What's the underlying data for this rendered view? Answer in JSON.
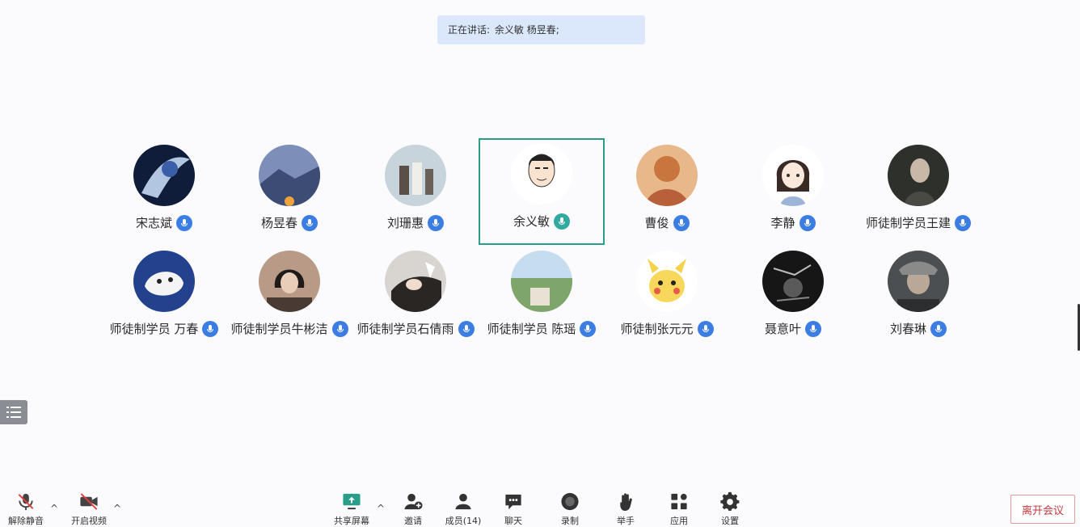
{
  "speaking": {
    "label": "正在讲话:",
    "names": "余义敏 杨昱春;"
  },
  "participants": [
    {
      "name": "宋志斌",
      "avatar": "avatar-night-swirl",
      "mic": "blue"
    },
    {
      "name": "杨昱春",
      "avatar": "avatar-mountain",
      "mic": "blue"
    },
    {
      "name": "刘珊惠",
      "avatar": "avatar-group-photo",
      "mic": "blue"
    },
    {
      "name": "余义敏",
      "avatar": "avatar-cartoon-man",
      "mic": "green",
      "active": true
    },
    {
      "name": "曹俊",
      "avatar": "avatar-painting",
      "mic": "blue"
    },
    {
      "name": "李静",
      "avatar": "avatar-cartoon-girl",
      "mic": "blue"
    },
    {
      "name": "师徒制学员王建",
      "avatar": "avatar-dark-portrait",
      "mic": "blue"
    },
    {
      "name": "师徒制学员 万春",
      "avatar": "avatar-cat",
      "mic": "blue"
    },
    {
      "name": "师徒制学员牛彬洁",
      "avatar": "avatar-girl-photo",
      "mic": "blue"
    },
    {
      "name": "师徒制学员石倩雨",
      "avatar": "avatar-sleeping",
      "mic": "blue"
    },
    {
      "name": "师徒制学员 陈瑶",
      "avatar": "avatar-landscape",
      "mic": "blue"
    },
    {
      "name": "师徒制张元元",
      "avatar": "avatar-pikachu",
      "mic": "blue"
    },
    {
      "name": "聂意叶",
      "avatar": "avatar-black-white",
      "mic": "blue"
    },
    {
      "name": "刘春琳",
      "avatar": "avatar-child-photo",
      "mic": "blue"
    }
  ],
  "toolbar": {
    "mute": "解除静音",
    "video": "开启视频",
    "share": "共享屏幕",
    "invite": "邀请",
    "members": "成员(14)",
    "chat": "聊天",
    "record": "录制",
    "raise_hand": "举手",
    "apps": "应用",
    "settings": "设置",
    "leave": "离开会议"
  },
  "colors": {
    "active_border": "#2a9d8a",
    "mic_blue": "#3c7de3",
    "leave_red": "#c23a3a"
  }
}
